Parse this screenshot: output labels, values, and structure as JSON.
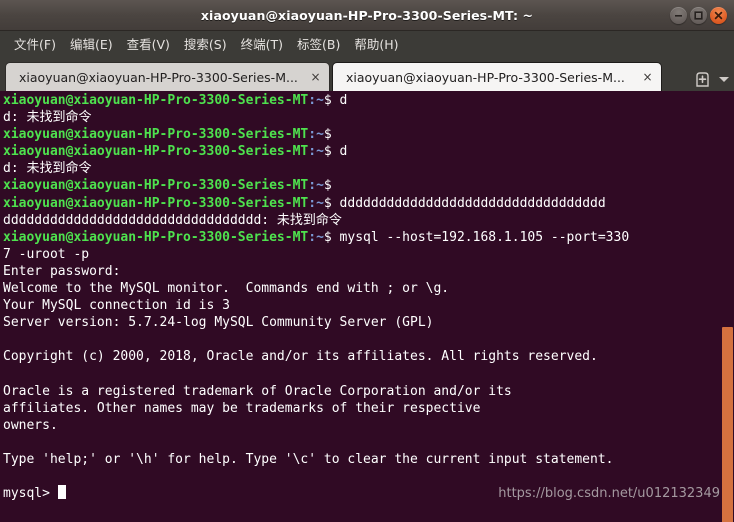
{
  "window": {
    "title": "xiaoyuan@xiaoyuan-HP-Pro-3300-Series-MT: ~",
    "buttons": {
      "minimize": "minimize",
      "maximize": "maximize",
      "close": "close"
    }
  },
  "menubar": {
    "items": [
      {
        "label": "文件(F)"
      },
      {
        "label": "编辑(E)"
      },
      {
        "label": "查看(V)"
      },
      {
        "label": "搜索(S)"
      },
      {
        "label": "终端(T)"
      },
      {
        "label": "标签(B)"
      },
      {
        "label": "帮助(H)"
      }
    ]
  },
  "tabbar": {
    "tabs": [
      {
        "label": "xiaoyuan@xiaoyuan-HP-Pro-3300-Series-M...",
        "close": "×",
        "active": false
      },
      {
        "label": "xiaoyuan@xiaoyuan-HP-Pro-3300-Series-M...",
        "close": "×",
        "active": true
      }
    ],
    "new_tab_label": "new-tab",
    "tab_menu_label": "tab-list-menu"
  },
  "terminal": {
    "prompt_user": "xiaoyuan@xiaoyuan-HP-Pro-3300-Series-MT",
    "prompt_path": ":~",
    "prompt_sigil": "$",
    "lines": [
      {
        "type": "prompt",
        "command": " d"
      },
      {
        "type": "output",
        "text": "d: 未找到命令"
      },
      {
        "type": "prompt",
        "command": ""
      },
      {
        "type": "prompt",
        "command": " d"
      },
      {
        "type": "output",
        "text": "d: 未找到命令"
      },
      {
        "type": "prompt",
        "command": ""
      },
      {
        "type": "prompt",
        "command": " dddddddddddddddddddddddddddddddddd"
      },
      {
        "type": "output",
        "text": "ddddddddddddddddddddddddddddddddd: 未找到命令"
      },
      {
        "type": "prompt",
        "command": " mysql --host=192.168.1.105 --port=330"
      },
      {
        "type": "output",
        "text": "7 -uroot -p"
      },
      {
        "type": "output",
        "text": "Enter password:"
      },
      {
        "type": "output",
        "text": "Welcome to the MySQL monitor.  Commands end with ; or \\g."
      },
      {
        "type": "output",
        "text": "Your MySQL connection id is 3"
      },
      {
        "type": "output",
        "text": "Server version: 5.7.24-log MySQL Community Server (GPL)"
      },
      {
        "type": "output",
        "text": ""
      },
      {
        "type": "output",
        "text": "Copyright (c) 2000, 2018, Oracle and/or its affiliates. All rights reserved."
      },
      {
        "type": "output",
        "text": ""
      },
      {
        "type": "output",
        "text": "Oracle is a registered trademark of Oracle Corporation and/or its"
      },
      {
        "type": "output",
        "text": "affiliates. Other names may be trademarks of their respective"
      },
      {
        "type": "output",
        "text": "owners."
      },
      {
        "type": "output",
        "text": ""
      },
      {
        "type": "output",
        "text": "Type 'help;' or '\\h' for help. Type '\\c' to clear the current input statement."
      },
      {
        "type": "output",
        "text": ""
      },
      {
        "type": "mysql_prompt",
        "text": "mysql> "
      }
    ],
    "watermark": "https://blog.csdn.net/u012132349"
  },
  "colors": {
    "terminal_background": "#300a24",
    "prompt_green": "#4ee24e",
    "prompt_blue": "#7b9ad6",
    "output_white": "#ffffff",
    "scrollbar_orange": "#d4713f",
    "titlebar": "#4b4541",
    "close_button": "#e2622a"
  }
}
